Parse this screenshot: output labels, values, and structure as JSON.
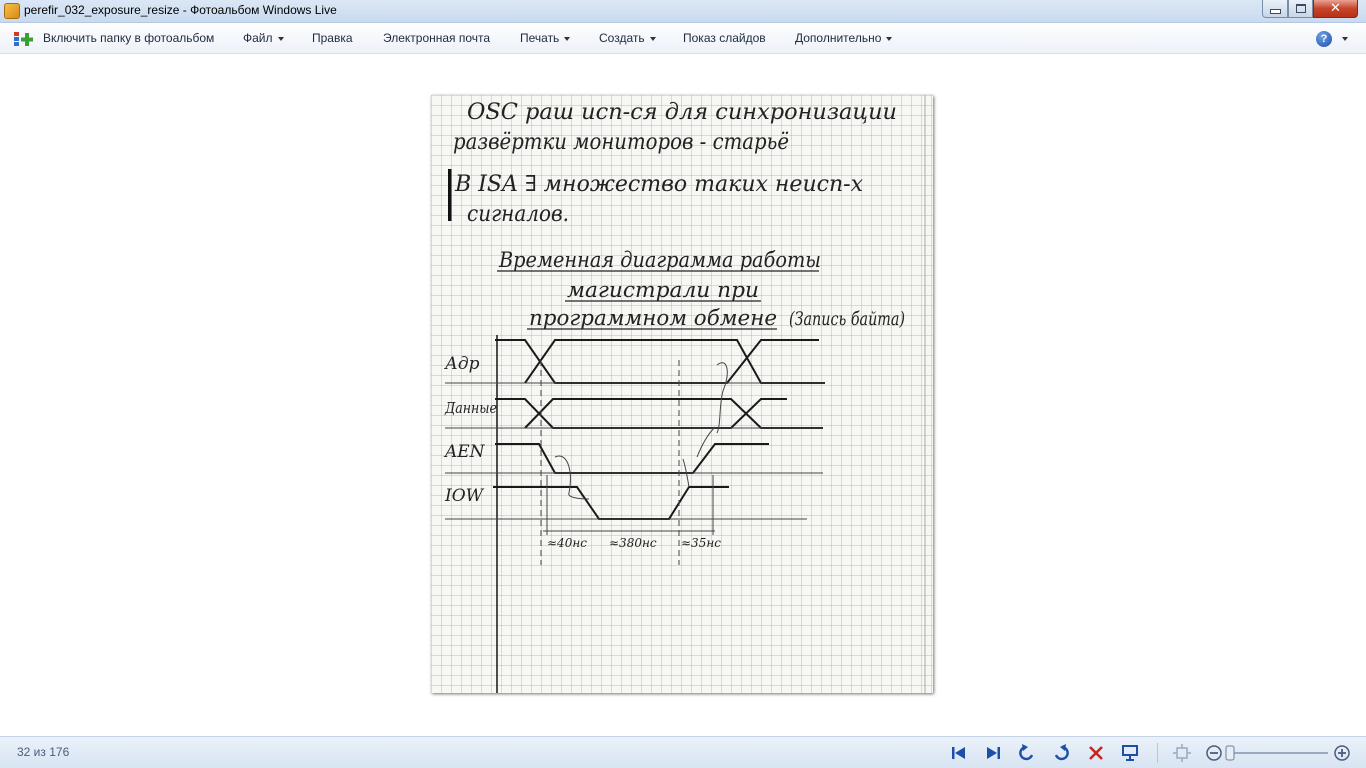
{
  "window": {
    "title": "perefir_032_exposure_resize - Фотоальбом Windows Live",
    "minimize_label": "",
    "close_label": "✕"
  },
  "toolbar": {
    "include_folder": "Включить папку в фотоальбом",
    "file": "Файл",
    "edit": "Правка",
    "email": "Электронная почта",
    "print": "Печать",
    "create": "Создать",
    "slideshow": "Показ слайдов",
    "more": "Дополнительно",
    "help": "?"
  },
  "photo": {
    "notes": {
      "line1": "OSC раш исп-ся для синхронизации",
      "line2": "развёртки мониторов - старьё",
      "line3": "В ISA ∃ множество таких неисп-х",
      "line4": "сигналов.",
      "heading1": "Временная диаграмма работы",
      "heading2": "магистрали при",
      "heading3": "программном обмене",
      "heading_note": "(Запись байта)"
    },
    "signals": [
      "Адр",
      "Данные",
      "AEN",
      "IOW"
    ],
    "timings": [
      "≈40нс",
      "≈380нс",
      "≈35нс"
    ]
  },
  "status": {
    "counter": "32 из 176"
  },
  "colors": {
    "accent": "#1c4fa8",
    "delete": "#c8261a",
    "titlebar": "#c9daef"
  },
  "zoom": {
    "level_fraction": 0.0
  }
}
